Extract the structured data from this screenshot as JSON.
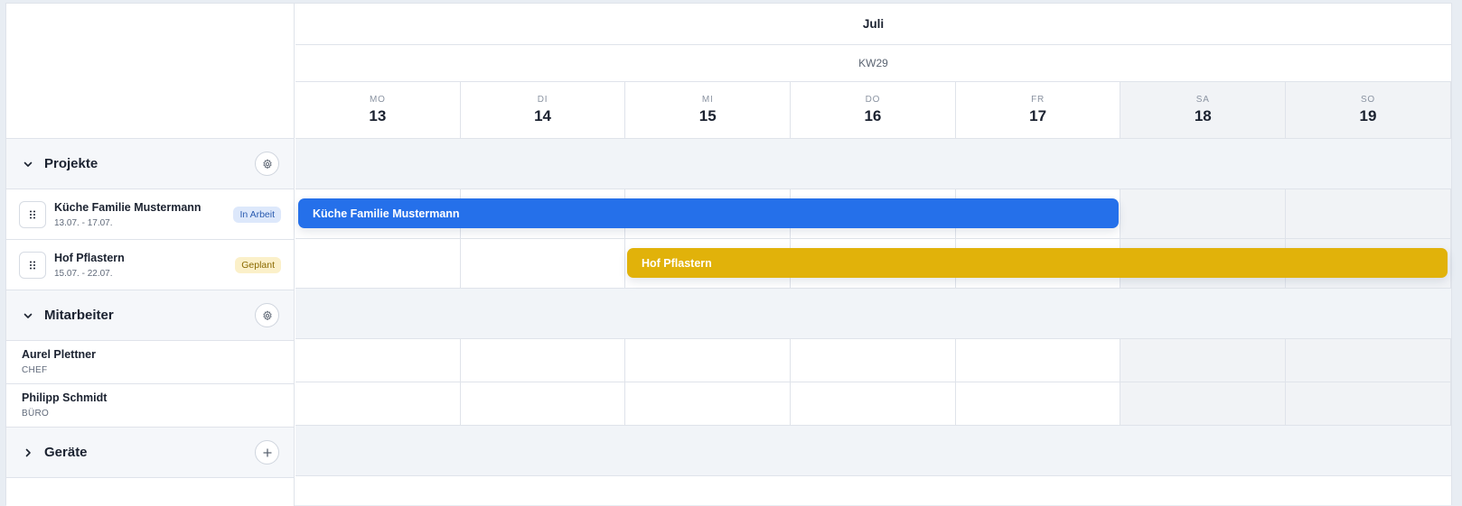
{
  "header": {
    "month": "Juli",
    "week": "KW29"
  },
  "days": [
    {
      "name": "MO",
      "num": "13"
    },
    {
      "name": "DI",
      "num": "14"
    },
    {
      "name": "MI",
      "num": "15"
    },
    {
      "name": "DO",
      "num": "16"
    },
    {
      "name": "FR",
      "num": "17"
    },
    {
      "name": "SA",
      "num": "18"
    },
    {
      "name": "SO",
      "num": "19"
    }
  ],
  "sections": {
    "projects": "Projekte",
    "employees": "Mitarbeiter",
    "devices": "Geräte"
  },
  "projects": [
    {
      "name": "Küche Familie Mustermann",
      "dates": "13.07. - 17.07.",
      "status": "In Arbeit",
      "bar_label": "Küche Familie Mustermann",
      "color": "#2570ea"
    },
    {
      "name": "Hof Pflastern",
      "dates": "15.07. - 22.07.",
      "status": "Geplant",
      "bar_label": "Hof Pflastern",
      "color": "#e1b20a"
    }
  ],
  "employees": [
    {
      "name": "Aurel Plettner",
      "role": "CHEF"
    },
    {
      "name": "Philipp Schmidt",
      "role": "BÜRO"
    }
  ],
  "icons": {
    "section_expanded": "chevron-down-icon",
    "section_collapsed": "chevron-right-icon",
    "settings": "gear-icon",
    "add": "plus-icon",
    "drag": "drag-handle-icon"
  }
}
